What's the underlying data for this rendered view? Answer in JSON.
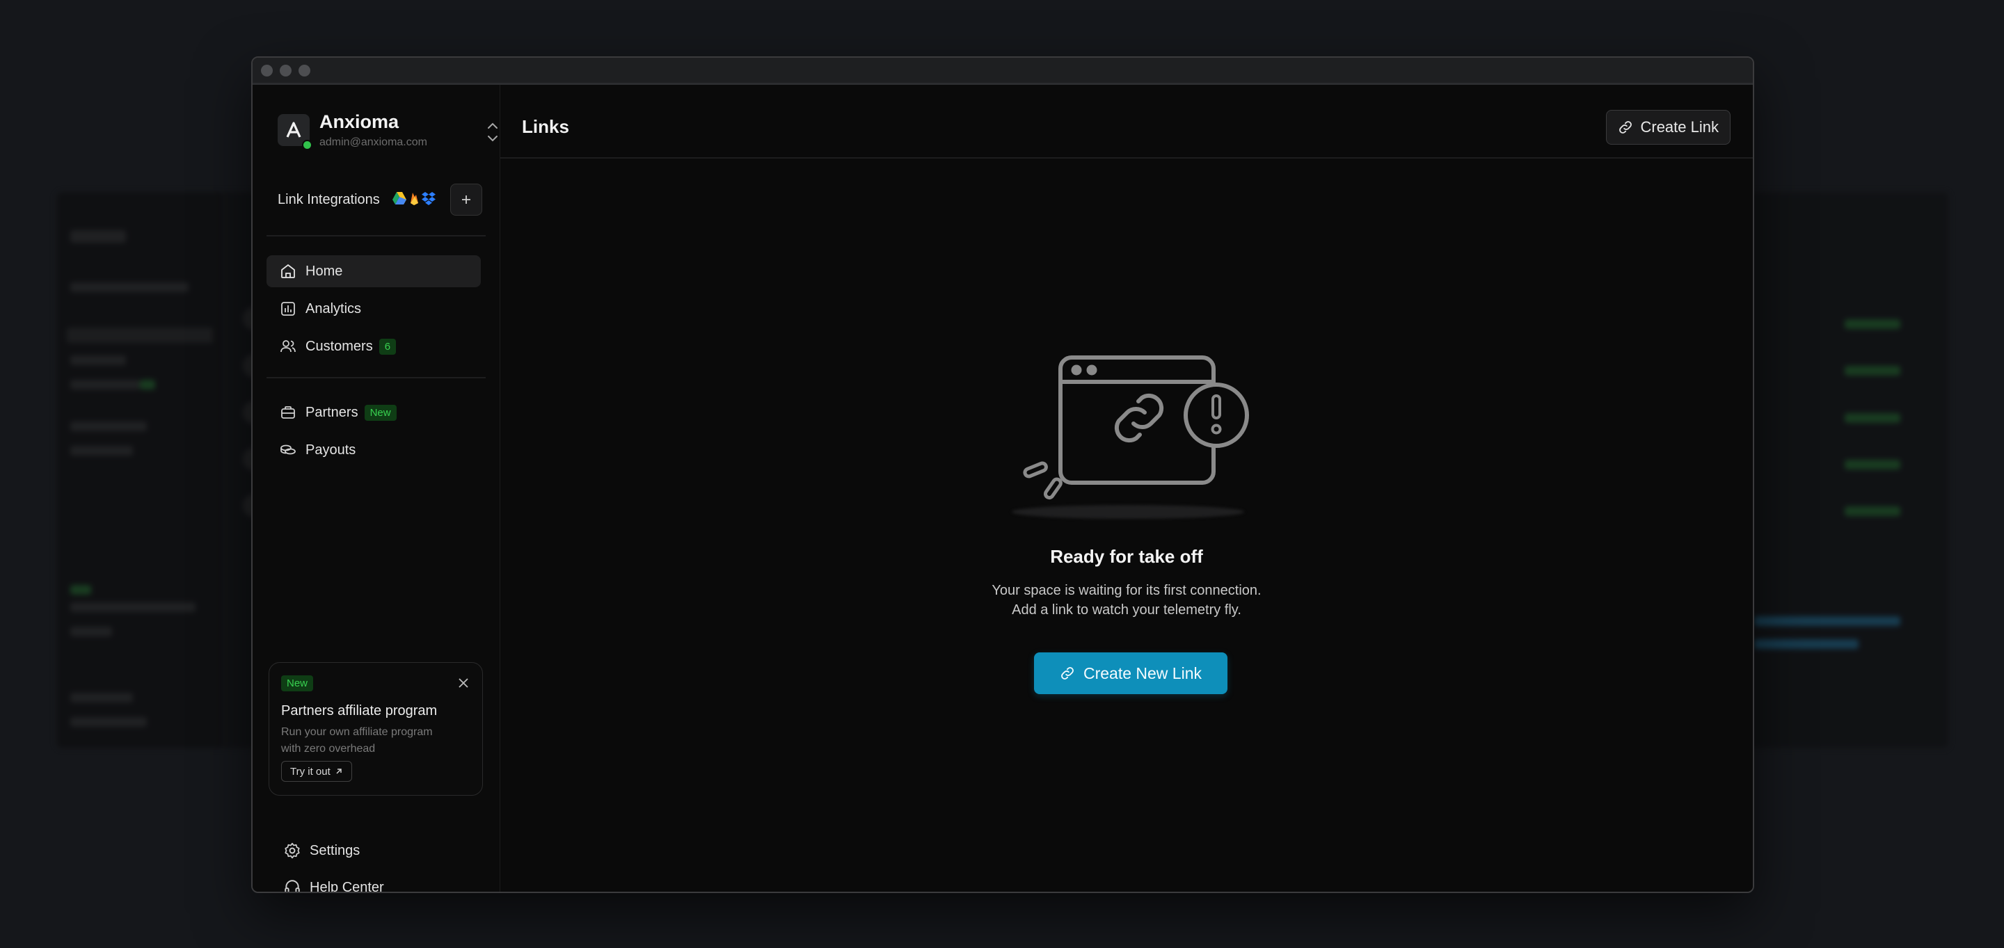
{
  "workspace": {
    "name": "Anxioma",
    "email": "admin@anxioma.com"
  },
  "integrations": {
    "label": "Link Integrations",
    "icons": [
      "google-drive-icon",
      "firebase-icon",
      "dropbox-icon"
    ]
  },
  "nav": {
    "primary": [
      {
        "label": "Home",
        "icon": "home-icon",
        "active": true
      },
      {
        "label": "Analytics",
        "icon": "analytics-icon"
      },
      {
        "label": "Customers",
        "icon": "users-icon",
        "badge": "6"
      }
    ],
    "secondary": [
      {
        "label": "Partners",
        "icon": "briefcase-icon",
        "badge": "New"
      },
      {
        "label": "Payouts",
        "icon": "coins-icon"
      }
    ]
  },
  "promo": {
    "badge": "New",
    "title": "Partners affiliate program",
    "text": "Run your own affiliate program with zero overhead",
    "button": "Try it out"
  },
  "bottom_nav": [
    {
      "label": "Settings",
      "icon": "gear-icon"
    },
    {
      "label": "Help Center",
      "icon": "headset-icon"
    }
  ],
  "header": {
    "title": "Links",
    "create_button": "Create Link"
  },
  "empty_state": {
    "title": "Ready for take off",
    "line1": "Your space is waiting for its first connection.",
    "line2": "Add a link to watch your telemetry fly.",
    "button": "Create New Link"
  },
  "colors": {
    "accent": "#0e8fba",
    "badge_bg": "#0f3d15",
    "badge_text": "#38d150",
    "background": "#0a0a0a"
  }
}
